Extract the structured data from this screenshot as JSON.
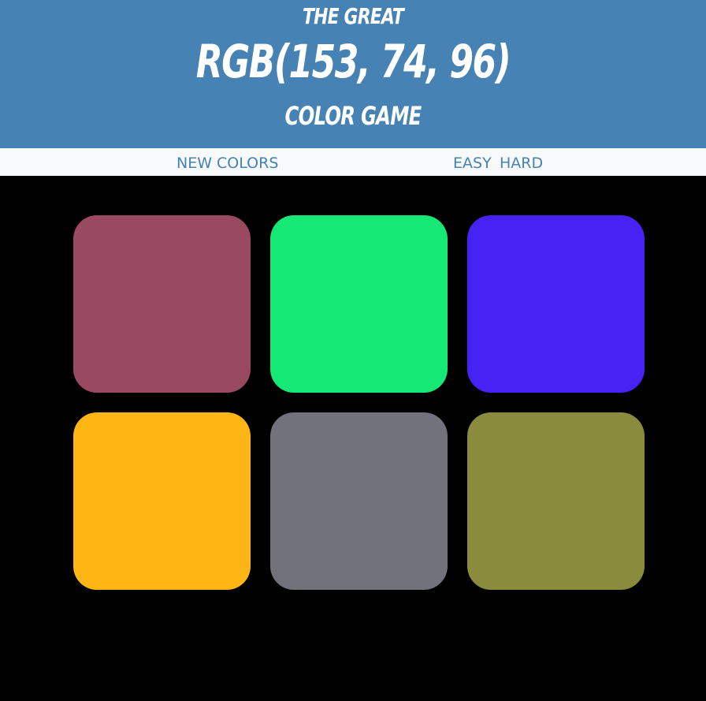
{
  "header": {
    "line_top": "THE GREAT",
    "rgb_target": "RGB(153, 74, 96)",
    "line_bottom": "COLOR GAME",
    "background": "#4682b4",
    "text_color": "#ffffff"
  },
  "stripe": {
    "new_colors_label": "NEW COLORS",
    "easy_label": "EASY",
    "hard_label": "HARD",
    "background": "#f7f9fb",
    "text_color": "#4682b4"
  },
  "board": {
    "background": "#000000",
    "squares": [
      {
        "color": "#994a60"
      },
      {
        "color": "#16e876"
      },
      {
        "color": "#4622f4"
      },
      {
        "color": "#ffb513"
      },
      {
        "color": "#72727c"
      },
      {
        "color": "#8a8b3c"
      }
    ]
  }
}
